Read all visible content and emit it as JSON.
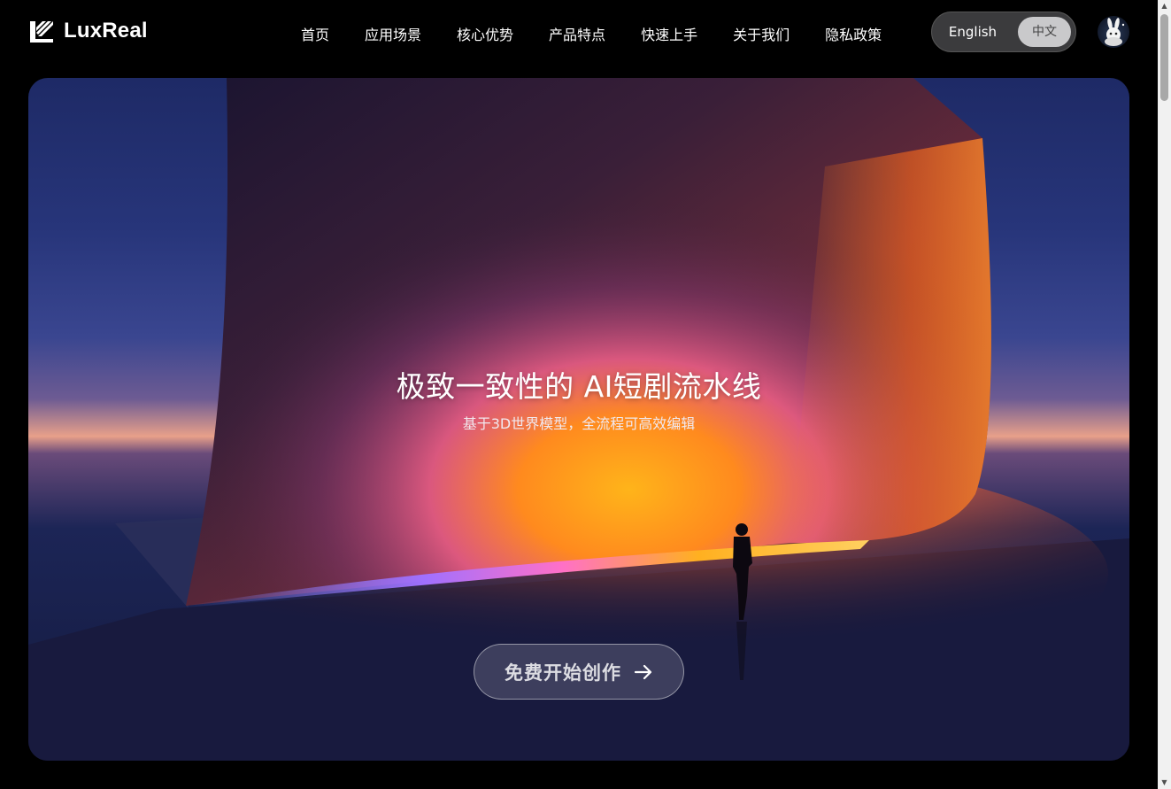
{
  "brand": {
    "name": "LuxReal",
    "logo_icon": "luxreal-logo-mark"
  },
  "nav": {
    "items": [
      {
        "label": "首页"
      },
      {
        "label": "应用场景"
      },
      {
        "label": "核心优势"
      },
      {
        "label": "产品特点"
      },
      {
        "label": "快速上手"
      },
      {
        "label": "关于我们"
      },
      {
        "label": "隐私政策"
      }
    ]
  },
  "language": {
    "options": [
      "English",
      "中文"
    ],
    "selected": "中文"
  },
  "user": {
    "avatar_icon": "rabbit-avatar"
  },
  "hero": {
    "title": "极致一致性的 AI短剧流水线",
    "subtitle": "基于3D世界模型，全流程可高效编辑",
    "cta_label": "免费开始创作",
    "cta_icon": "arrow-right-icon"
  },
  "scrollbar": {
    "up_icon": "▲",
    "down_icon": "▼"
  },
  "colors": {
    "page_background": "#000000",
    "lang_toggle_bg": "#3b3b3d",
    "lang_selected_bg": "#c9c9cb"
  }
}
